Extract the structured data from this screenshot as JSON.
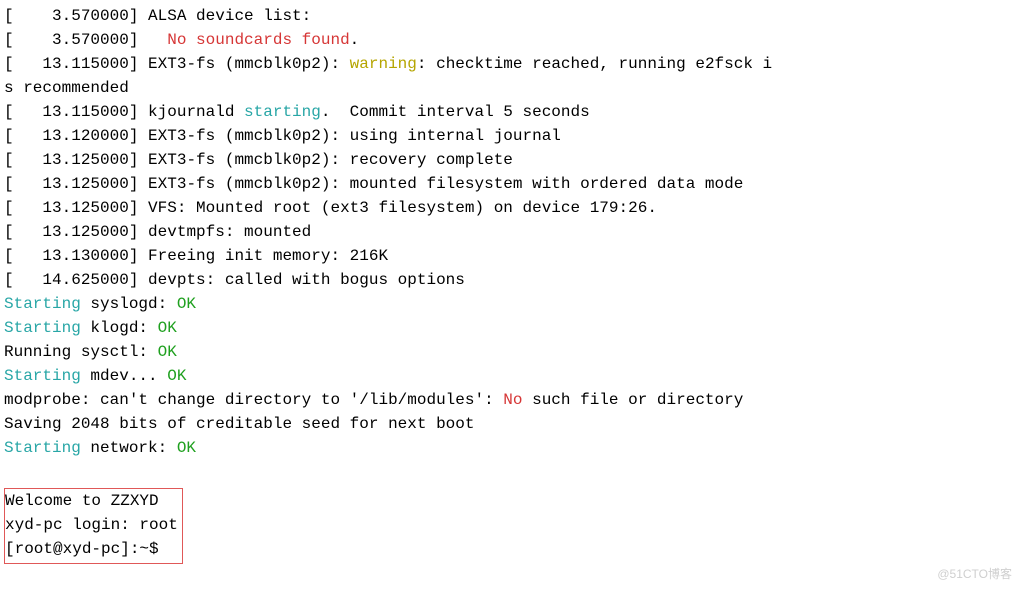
{
  "kernel": {
    "l0": {
      "prefix": "[    3.570000] ",
      "msg": "ALSA device list:"
    },
    "l1": {
      "prefix": "[    3.570000]   ",
      "red": "No soundcards found",
      "after": "."
    },
    "l2": {
      "prefix": "[   13.115000] ",
      "before": "EXT3-fs (mmcblk0p2): ",
      "yellow": "warning",
      "after": ": checktime reached, running e2fsck i"
    },
    "l2b": {
      "msg": "s recommended"
    },
    "l3": {
      "prefix": "[   13.115000] ",
      "before": "kjournald ",
      "cyan": "starting",
      "after": ".  Commit interval 5 seconds"
    },
    "l4": {
      "prefix": "[   13.120000] ",
      "msg": "EXT3-fs (mmcblk0p2): using internal journal"
    },
    "l5": {
      "prefix": "[   13.125000] ",
      "msg": "EXT3-fs (mmcblk0p2): recovery complete"
    },
    "l6": {
      "prefix": "[   13.125000] ",
      "msg": "EXT3-fs (mmcblk0p2): mounted filesystem with ordered data mode"
    },
    "l7": {
      "prefix": "[   13.125000] ",
      "msg": "VFS: Mounted root (ext3 filesystem) on device 179:26."
    },
    "l8": {
      "prefix": "[   13.125000] ",
      "msg": "devtmpfs: mounted"
    },
    "l9": {
      "prefix": "[   13.130000] ",
      "msg": "Freeing init memory: 216K"
    },
    "l10": {
      "prefix": "[   14.625000] ",
      "msg": "devpts: called with bogus options"
    }
  },
  "services": {
    "s0": {
      "cyan": "Starting",
      "label": " syslogd: ",
      "green": "OK"
    },
    "s1": {
      "cyan": "Starting",
      "label": " klogd: ",
      "green": "OK"
    },
    "s2": {
      "plain": "Running sysctl: ",
      "green": "OK"
    },
    "s3": {
      "cyan": "Starting",
      "label": " mdev... ",
      "green": "OK"
    },
    "s4": {
      "before": "modprobe: can't change directory to '/lib/modules': ",
      "red": "No",
      "after": " such file or directory"
    },
    "s5": {
      "msg": "Saving 2048 bits of creditable seed for next boot"
    },
    "s6": {
      "cyan": "Starting",
      "label": " network: ",
      "green": "OK"
    }
  },
  "login": {
    "welcome": "Welcome to ZZXYD",
    "prompt_label": "xyd-pc login: ",
    "prompt_value": "root",
    "shell_prompt": "[root@xyd-pc]:~$ "
  },
  "watermark": "@51CTO博客"
}
